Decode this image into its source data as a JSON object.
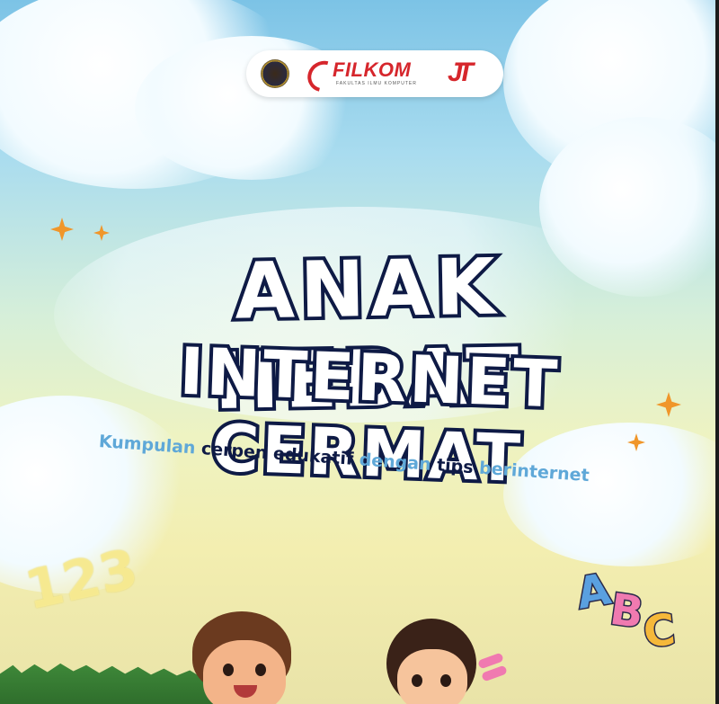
{
  "logos": {
    "university": "UB",
    "filkom_text": "FILKOM",
    "filkom_subtext": "FAKULTAS ILMU KOMPUTER",
    "jt_mark": "JT"
  },
  "title": {
    "line1": "ANAK HEBAT",
    "line2": "INTERNET CERMAT"
  },
  "subtitle": {
    "w1": "Kumpulan",
    "w2": "cerpen",
    "w3": "edukatif",
    "w4": "dengan",
    "w5": "tips",
    "w6": "berinternet"
  },
  "decor": {
    "numbers": "123",
    "letters": [
      "A",
      "B",
      "C"
    ]
  },
  "colors": {
    "title_fill": "#ffffff",
    "title_outline": "#0e1a45",
    "sparkle": "#f0962a",
    "accent_red": "#d6262c",
    "subtitle_blue": "#5fa8d8"
  }
}
